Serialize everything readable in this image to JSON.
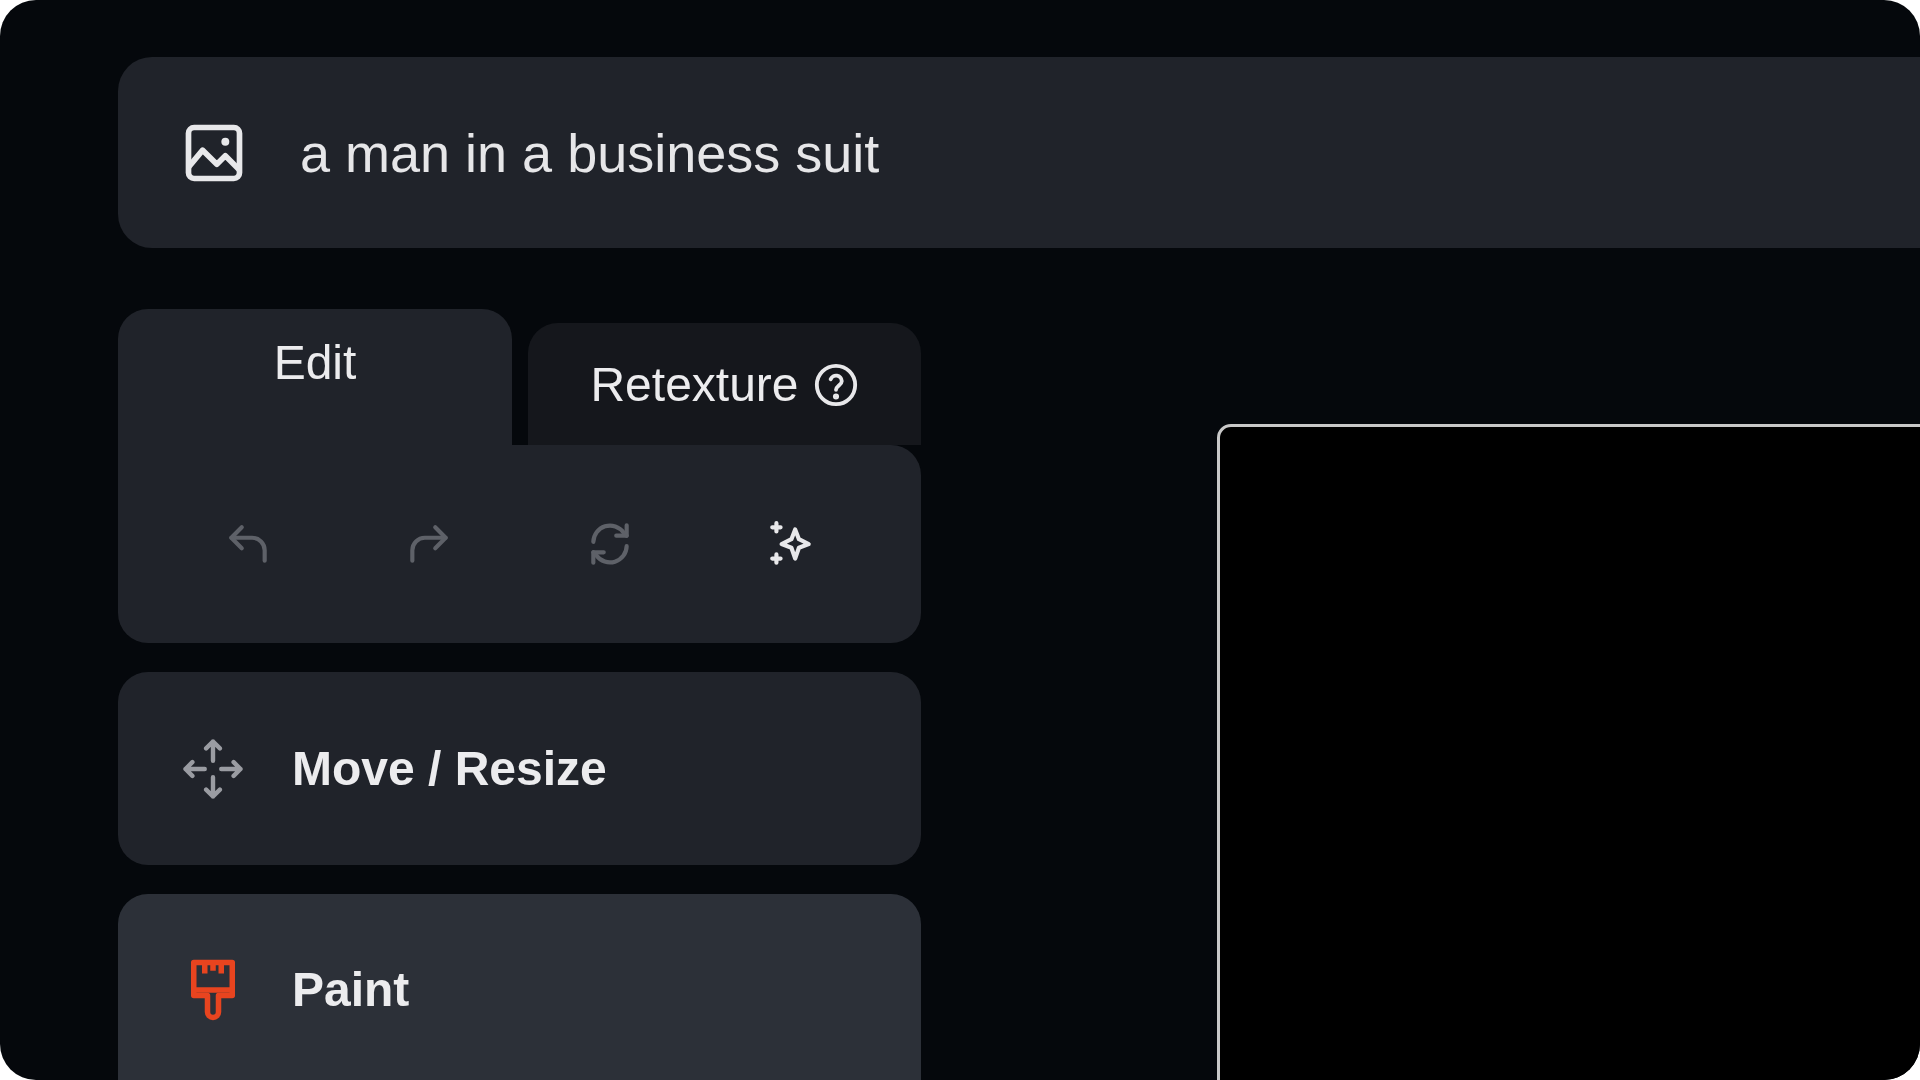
{
  "prompt": {
    "value": "a man in a business suit"
  },
  "tabs": [
    {
      "label": "Edit",
      "selected": true,
      "help": false
    },
    {
      "label": "Retexture",
      "selected": false,
      "help": true
    }
  ],
  "toolbar": [
    {
      "kind": "undo",
      "disabled": true
    },
    {
      "kind": "redo",
      "disabled": true
    },
    {
      "kind": "refresh",
      "disabled": true
    },
    {
      "kind": "sparkle",
      "disabled": false
    }
  ],
  "tools": [
    {
      "kind": "move",
      "label": "Move / Resize",
      "selected": false
    },
    {
      "kind": "paint",
      "label": "Paint",
      "selected": true
    }
  ]
}
